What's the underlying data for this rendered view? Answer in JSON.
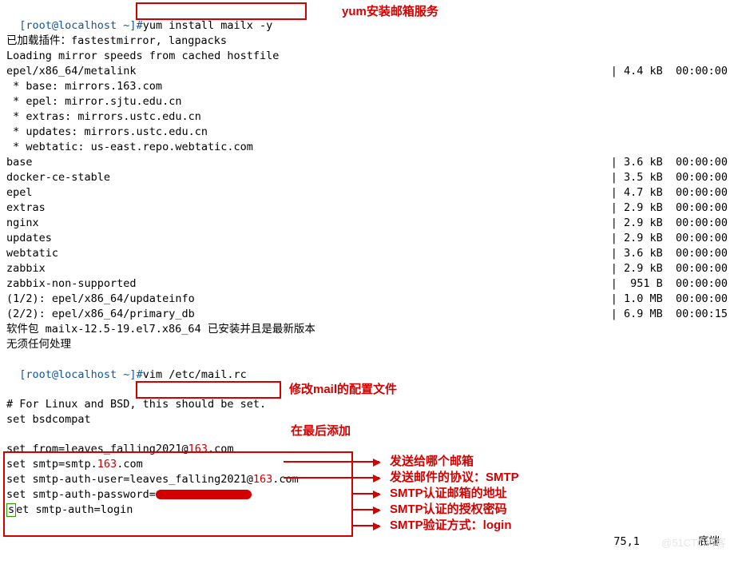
{
  "prompt1": {
    "user": "[root@localhost ~]",
    "hash": "#",
    "cmd": "yum install mailx -y"
  },
  "anno_yum": "yum安装邮箱服务",
  "out1": "已加载插件：fastestmirror, langpacks",
  "out2": "Loading mirror speeds from cached hostfile",
  "epel_meta": {
    "l": "epel/x86_64/metalink",
    "r": "| 4.4 kB  00:00:00"
  },
  "mirrors": [
    " * base: mirrors.163.com",
    " * epel: mirror.sjtu.edu.cn",
    " * extras: mirrors.ustc.edu.cn",
    " * updates: mirrors.ustc.edu.cn",
    " * webtatic: us-east.repo.webtatic.com"
  ],
  "repos": [
    {
      "l": "base",
      "r": "| 3.6 kB  00:00:00"
    },
    {
      "l": "docker-ce-stable",
      "r": "| 3.5 kB  00:00:00"
    },
    {
      "l": "epel",
      "r": "| 4.7 kB  00:00:00"
    },
    {
      "l": "extras",
      "r": "| 2.9 kB  00:00:00"
    },
    {
      "l": "nginx",
      "r": "| 2.9 kB  00:00:00"
    },
    {
      "l": "updates",
      "r": "| 2.9 kB  00:00:00"
    },
    {
      "l": "webtatic",
      "r": "| 3.6 kB  00:00:00"
    },
    {
      "l": "zabbix",
      "r": "| 2.9 kB  00:00:00"
    },
    {
      "l": "zabbix-non-supported",
      "r": "|  951 B  00:00:00"
    },
    {
      "l": "(1/2): epel/x86_64/updateinfo",
      "r": "| 1.0 MB  00:00:00"
    },
    {
      "l": "(2/2): epel/x86_64/primary_db",
      "r": "| 6.9 MB  00:00:15"
    }
  ],
  "pkg_line": "软件包 mailx-12.5-19.el7.x86_64 已安装并且是最新版本",
  "noop": "无须任何处理",
  "prompt2": {
    "user": "[root@localhost ~]",
    "hash": "#",
    "cmd": "vim /etc/mail.rc"
  },
  "anno_vim": "修改mail的配置文件",
  "vim_comment": "# For Linux and BSD, this should be set.",
  "vim_set": "set bsdcompat",
  "anno_add": "在最后添加",
  "cfg": {
    "from_a": "set from=leaves_falling2021@",
    "from_b": "163",
    "from_c": ".com",
    "smtp_a": "set smtp=smtp.",
    "smtp_b": "163",
    "smtp_c": ".com",
    "user_a": "set smtp-auth-user=leaves_falling2021@",
    "user_b": "163",
    "user_c": ".com",
    "pass": "set smtp-auth-password=",
    "auth_a": "s",
    "auth_b": "et smtp-auth=login"
  },
  "explain": {
    "from": "发送给哪个邮箱",
    "smtp": "发送邮件的协议：SMTP",
    "user": "SMTP认证邮箱的地址",
    "pass": "SMTP认证的授权密码",
    "auth": "SMTP验证方式：login"
  },
  "status": {
    "pos": "75,1",
    "end": "底端"
  },
  "wm1": "@51CTO博客",
  "colors": {
    "blue": "#1256a0",
    "red": "#c80000",
    "anno": "#d40000"
  }
}
